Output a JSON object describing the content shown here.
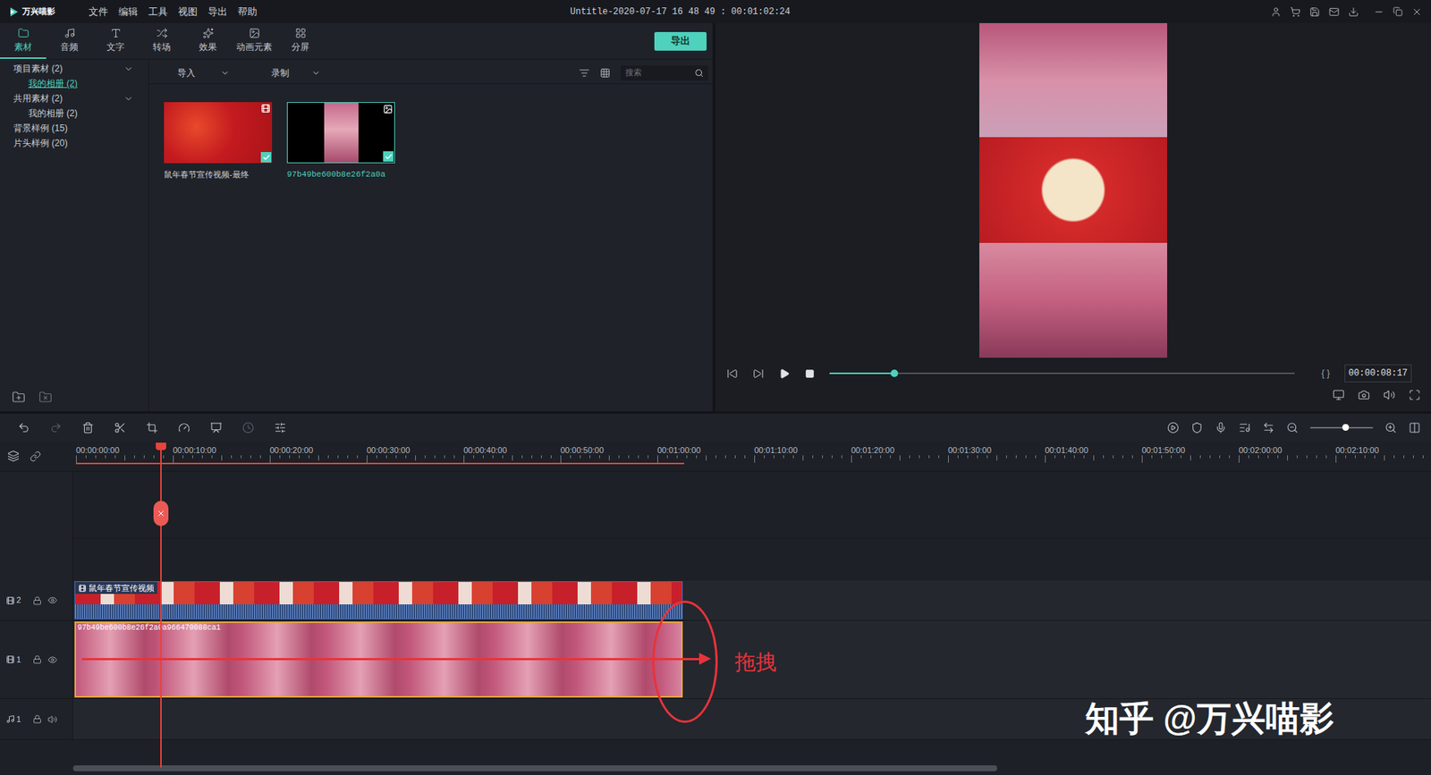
{
  "app": {
    "logo": "万兴喵影",
    "title": "Untitle-2020-07-17 16 48 49 : 00:01:02:24"
  },
  "menu": [
    "文件",
    "编辑",
    "工具",
    "视图",
    "导出",
    "帮助"
  ],
  "tabs": [
    {
      "label": "素材",
      "selected": true
    },
    {
      "label": "音频",
      "selected": false
    },
    {
      "label": "文字",
      "selected": false
    },
    {
      "label": "转场",
      "selected": false
    },
    {
      "label": "效果",
      "selected": false
    },
    {
      "label": "动画元素",
      "selected": false
    },
    {
      "label": "分屏",
      "selected": false
    }
  ],
  "export_button": "导出",
  "sidebar": [
    {
      "label": "项目素材 (2)",
      "kind": "group",
      "expanded": true,
      "selected": false
    },
    {
      "label": "我的相册 (2)",
      "kind": "child",
      "selected": true
    },
    {
      "label": "共用素材 (2)",
      "kind": "group",
      "expanded": true,
      "selected": false
    },
    {
      "label": "我的相册 (2)",
      "kind": "child",
      "selected": false
    },
    {
      "label": "背景样例 (15)",
      "kind": "leaf",
      "selected": false
    },
    {
      "label": "片头样例 (20)",
      "kind": "leaf",
      "selected": false
    }
  ],
  "media_toolbar": {
    "import": "导入",
    "record": "录制",
    "search_placeholder": "搜索"
  },
  "media": [
    {
      "name": "鼠年春节宣传视频-最终",
      "kind": "video",
      "selected": false,
      "checked": true
    },
    {
      "name": "97b49be600b8e26f2a0a",
      "kind": "image",
      "selected": true,
      "checked": true
    }
  ],
  "preview": {
    "time": "00:00:08:17",
    "level": 0.14,
    "brackets": "{ }"
  },
  "timeline": {
    "zoom_level": 0.56,
    "playhead_seconds": 8.7,
    "work_area_seconds": 62.8,
    "ruler": [
      "00:00:00:00",
      "00:00:10:00",
      "00:00:20:00",
      "00:00:30:00",
      "00:00:40:00",
      "00:00:50:00",
      "00:01:00:00",
      "00:01:10:00",
      "00:01:20:00",
      "00:01:30:00",
      "00:01:40:00",
      "00:01:50:00",
      "00:02:00:00",
      "00:02:10:00"
    ],
    "tracks": [
      {
        "kind": "video",
        "number": "2",
        "clip": {
          "name": "鼠年春节宣传视频",
          "seconds": 62.8,
          "selected": false,
          "style": "festival"
        }
      },
      {
        "kind": "video",
        "number": "1",
        "clip": {
          "name": "97b49be600b8e26f2a0a966470088ca1",
          "seconds": 62.8,
          "selected": true,
          "style": "sky"
        }
      },
      {
        "kind": "audio",
        "number": "1",
        "clip": null
      }
    ]
  },
  "annotation": {
    "label": "拖拽"
  },
  "watermark": "知乎 @万兴喵影"
}
